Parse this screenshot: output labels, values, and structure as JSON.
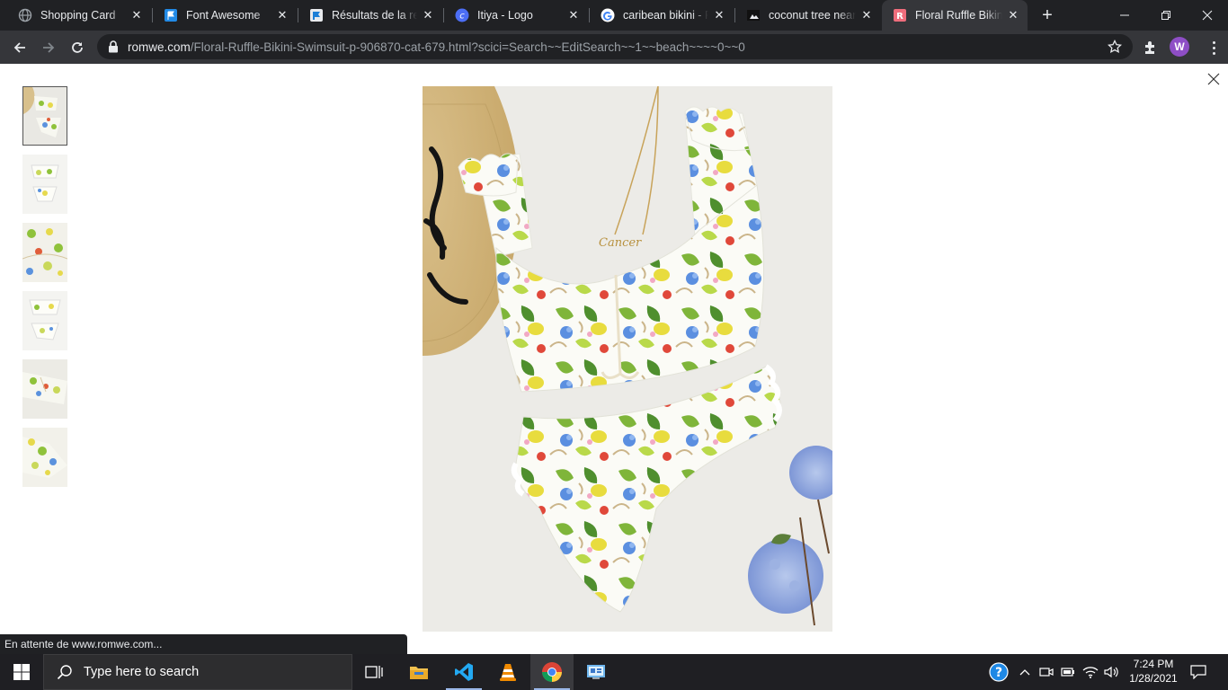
{
  "browser": {
    "tabs": [
      {
        "title": "Shopping Card",
        "favicon": "globe-icon",
        "active": false
      },
      {
        "title": "Font Awesome",
        "favicon": "flag-icon",
        "active": false
      },
      {
        "title": "Résultats de la rec",
        "favicon": "fontawesome-icon",
        "active": false
      },
      {
        "title": "Itiya - Logo",
        "favicon": "c-logo-icon",
        "active": false
      },
      {
        "title": "caribean bikini - Re",
        "favicon": "google-icon",
        "active": false
      },
      {
        "title": "coconut tree near",
        "favicon": "image-icon",
        "active": false
      },
      {
        "title": "Floral Ruffle Bikini",
        "favicon": "romwe-icon",
        "active": true
      }
    ],
    "url_host": "romwe.com",
    "url_path": "/Floral-Ruffle-Bikini-Swimsuit-p-906870-cat-679.html?scici=Search~~EditSearch~~1~~beach~~~~0~~0",
    "profile_initial": "W",
    "status_text": "En attente de www.romwe.com..."
  },
  "gallery": {
    "thumbnails": [
      "thumb-1",
      "thumb-2",
      "thumb-3",
      "thumb-4",
      "thumb-5",
      "thumb-6"
    ],
    "necklace_text": "Cancer"
  },
  "taskbar": {
    "search_placeholder": "Type here to search",
    "time": "7:24 PM",
    "date": "1/28/2021"
  },
  "colors": {
    "tabstrip": "#202124",
    "toolbar": "#35363a",
    "omnibox": "#202124",
    "profile": "#8e4ec6",
    "taskbar": "#1f1f23",
    "chrome_accent": "#4285f4"
  }
}
